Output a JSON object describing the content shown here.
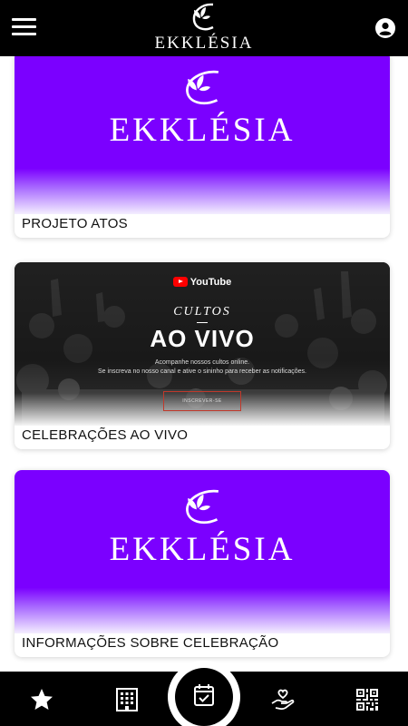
{
  "header": {
    "app_name": "EKKLÉSIA",
    "menu_icon": "hamburger-menu-icon",
    "profile_icon": "user-account-icon"
  },
  "cards": [
    {
      "title": "PROJETO ATOS",
      "banner_text": "EKKLÉSIA"
    },
    {
      "title": "CELEBRAÇÕES AO VIVO",
      "banner": {
        "brand": "YouTube",
        "script": "CULTOS",
        "headline": "AO VIVO",
        "line1": "Acompanhe nossos cultos online.",
        "line2": "Se inscreva no nosso canal e ative o sininho para receber as notificações.",
        "button": "INSCREVER-SE"
      }
    },
    {
      "title": "INFORMAÇÕES SOBRE CELEBRAÇÃO",
      "banner_text": "EKKLÉSIA"
    }
  ],
  "bottom_nav": {
    "items": [
      "star-icon",
      "building-icon",
      "calendar-check-icon",
      "heart-hand-icon",
      "qr-code-icon"
    ]
  },
  "colors": {
    "brand_purple": "#7b00ff",
    "bar_black": "#000000",
    "youtube_red": "#ff0000"
  }
}
